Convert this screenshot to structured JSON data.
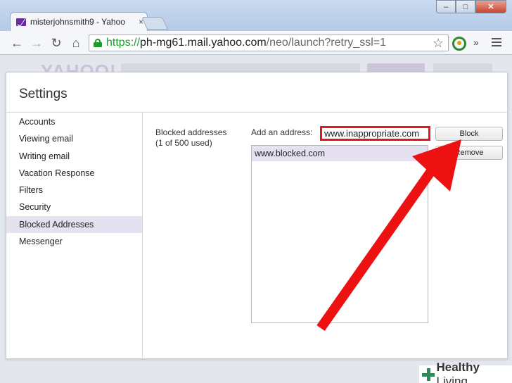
{
  "browser": {
    "tab_title": "misterjohnsmith9 - Yahoo",
    "tab_close": "×",
    "url_scheme": "https://",
    "url_host": "ph-mg61.mail.yahoo.com",
    "url_path": "/neo/launch?retry_ssl=1",
    "more_label": "»",
    "window": {
      "minimize": "–",
      "maximize": "□",
      "close": "✕"
    }
  },
  "background": {
    "logo": "YAHOO!"
  },
  "settings": {
    "title": "Settings",
    "nav": [
      {
        "label": "Accounts"
      },
      {
        "label": "Viewing email"
      },
      {
        "label": "Writing email"
      },
      {
        "label": "Vacation Response"
      },
      {
        "label": "Filters"
      },
      {
        "label": "Security"
      },
      {
        "label": "Blocked Addresses",
        "active": true
      },
      {
        "label": "Messenger"
      }
    ],
    "blocked": {
      "heading": "Blocked addresses",
      "count": "(1 of 500 used)",
      "add_label": "Add an address:",
      "input_value": "www.inappropriate.com",
      "list": [
        "www.blocked.com"
      ],
      "block_label": "Block",
      "remove_label": "Remove"
    }
  },
  "watermark": {
    "bold": "Healthy",
    "light": " Living"
  },
  "colors": {
    "highlight": "#e8141a",
    "active_nav": "#e6e1f0",
    "secure": "#1d9b2b"
  }
}
